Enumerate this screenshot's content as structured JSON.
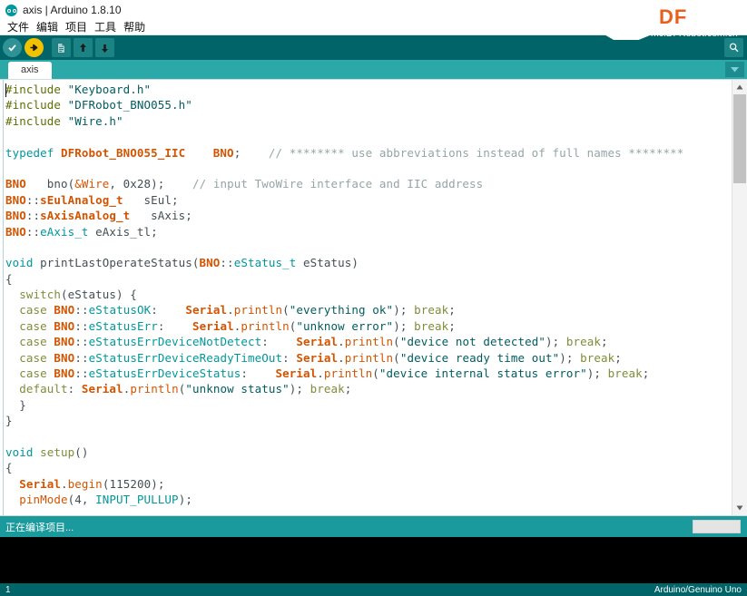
{
  "window": {
    "title": "axis | Arduino 1.8.10",
    "app_icon": "arduino-infinity-icon",
    "minimize_label": "–",
    "maximize_label": "□",
    "close_label": "✕"
  },
  "menubar": {
    "items": [
      {
        "label": "文件",
        "name": "menu-file"
      },
      {
        "label": "编辑",
        "name": "menu-edit"
      },
      {
        "label": "项目",
        "name": "menu-sketch"
      },
      {
        "label": "工具",
        "name": "menu-tools"
      },
      {
        "label": "帮助",
        "name": "menu-help"
      }
    ]
  },
  "toolbar": {
    "verify_label": "Verify",
    "upload_label": "Upload",
    "new_label": "New",
    "open_label": "Open",
    "save_label": "Save",
    "serial_monitor_label": "Serial Monitor"
  },
  "banner": {
    "logo_text": "DF",
    "url_text": "mc.DFRobot.com.cn",
    "logo_color": "#e8601c"
  },
  "tabbar": {
    "tabs": [
      {
        "label": "axis",
        "active": true
      }
    ],
    "menu_button_label": "▼"
  },
  "editor": {
    "lines": [
      {
        "segs": [
          {
            "t": "#include ",
            "c": "pre"
          },
          {
            "t": "\"Keyboard.h\"",
            "c": "str"
          }
        ]
      },
      {
        "segs": [
          {
            "t": "#include ",
            "c": "pre"
          },
          {
            "t": "\"DFRobot_BNO055.h\"",
            "c": "str"
          }
        ]
      },
      {
        "segs": [
          {
            "t": "#include ",
            "c": "pre"
          },
          {
            "t": "\"Wire.h\"",
            "c": "str"
          }
        ]
      },
      {
        "segs": []
      },
      {
        "segs": [
          {
            "t": "typedef ",
            "c": "kw"
          },
          {
            "t": "DFRobot_BNO055_IIC",
            "c": "type"
          },
          {
            "t": "    ",
            "c": "plain"
          },
          {
            "t": "BNO",
            "c": "type"
          },
          {
            "t": ";    ",
            "c": "plain"
          },
          {
            "t": "// ******** use abbreviations instead of full names ********",
            "c": "cmt"
          }
        ]
      },
      {
        "segs": []
      },
      {
        "segs": [
          {
            "t": "BNO",
            "c": "type"
          },
          {
            "t": "   bno(",
            "c": "plain"
          },
          {
            "t": "&Wire",
            "c": "fn"
          },
          {
            "t": ", 0x28);    ",
            "c": "plain"
          },
          {
            "t": "// input TwoWire interface and IIC address",
            "c": "cmt"
          }
        ]
      },
      {
        "segs": [
          {
            "t": "BNO",
            "c": "type"
          },
          {
            "t": "::",
            "c": "plain"
          },
          {
            "t": "sEulAnalog_t",
            "c": "type"
          },
          {
            "t": "   sEul;",
            "c": "plain"
          }
        ]
      },
      {
        "segs": [
          {
            "t": "BNO",
            "c": "type"
          },
          {
            "t": "::",
            "c": "plain"
          },
          {
            "t": "sAxisAnalog_t",
            "c": "type"
          },
          {
            "t": "   sAxis;",
            "c": "plain"
          }
        ]
      },
      {
        "segs": [
          {
            "t": "BNO",
            "c": "type"
          },
          {
            "t": "::",
            "c": "plain"
          },
          {
            "t": "eAxis_t",
            "c": "const"
          },
          {
            "t": " eAxis_tl;",
            "c": "plain"
          }
        ]
      },
      {
        "segs": []
      },
      {
        "segs": [
          {
            "t": "void",
            "c": "kw"
          },
          {
            "t": " printLastOperateStatus(",
            "c": "plain"
          },
          {
            "t": "BNO",
            "c": "type"
          },
          {
            "t": "::",
            "c": "plain"
          },
          {
            "t": "eStatus_t",
            "c": "const"
          },
          {
            "t": " eStatus)",
            "c": "plain"
          }
        ]
      },
      {
        "segs": [
          {
            "t": "{",
            "c": "plain"
          }
        ]
      },
      {
        "segs": [
          {
            "t": "  ",
            "c": "plain"
          },
          {
            "t": "switch",
            "c": "kw2"
          },
          {
            "t": "(eStatus) {",
            "c": "plain"
          }
        ]
      },
      {
        "segs": [
          {
            "t": "  ",
            "c": "plain"
          },
          {
            "t": "case",
            "c": "kw2"
          },
          {
            "t": " ",
            "c": "plain"
          },
          {
            "t": "BNO",
            "c": "type"
          },
          {
            "t": "::",
            "c": "plain"
          },
          {
            "t": "eStatusOK",
            "c": "const"
          },
          {
            "t": ":    ",
            "c": "plain"
          },
          {
            "t": "Serial",
            "c": "type"
          },
          {
            "t": ".",
            "c": "plain"
          },
          {
            "t": "println",
            "c": "fn"
          },
          {
            "t": "(",
            "c": "plain"
          },
          {
            "t": "\"everything ok\"",
            "c": "str"
          },
          {
            "t": "); ",
            "c": "plain"
          },
          {
            "t": "break",
            "c": "kw2"
          },
          {
            "t": ";",
            "c": "plain"
          }
        ]
      },
      {
        "segs": [
          {
            "t": "  ",
            "c": "plain"
          },
          {
            "t": "case",
            "c": "kw2"
          },
          {
            "t": " ",
            "c": "plain"
          },
          {
            "t": "BNO",
            "c": "type"
          },
          {
            "t": "::",
            "c": "plain"
          },
          {
            "t": "eStatusErr",
            "c": "const"
          },
          {
            "t": ":    ",
            "c": "plain"
          },
          {
            "t": "Serial",
            "c": "type"
          },
          {
            "t": ".",
            "c": "plain"
          },
          {
            "t": "println",
            "c": "fn"
          },
          {
            "t": "(",
            "c": "plain"
          },
          {
            "t": "\"unknow error\"",
            "c": "str"
          },
          {
            "t": "); ",
            "c": "plain"
          },
          {
            "t": "break",
            "c": "kw2"
          },
          {
            "t": ";",
            "c": "plain"
          }
        ]
      },
      {
        "segs": [
          {
            "t": "  ",
            "c": "plain"
          },
          {
            "t": "case",
            "c": "kw2"
          },
          {
            "t": " ",
            "c": "plain"
          },
          {
            "t": "BNO",
            "c": "type"
          },
          {
            "t": "::",
            "c": "plain"
          },
          {
            "t": "eStatusErrDeviceNotDetect",
            "c": "const"
          },
          {
            "t": ":    ",
            "c": "plain"
          },
          {
            "t": "Serial",
            "c": "type"
          },
          {
            "t": ".",
            "c": "plain"
          },
          {
            "t": "println",
            "c": "fn"
          },
          {
            "t": "(",
            "c": "plain"
          },
          {
            "t": "\"device not detected\"",
            "c": "str"
          },
          {
            "t": "); ",
            "c": "plain"
          },
          {
            "t": "break",
            "c": "kw2"
          },
          {
            "t": ";",
            "c": "plain"
          }
        ]
      },
      {
        "segs": [
          {
            "t": "  ",
            "c": "plain"
          },
          {
            "t": "case",
            "c": "kw2"
          },
          {
            "t": " ",
            "c": "plain"
          },
          {
            "t": "BNO",
            "c": "type"
          },
          {
            "t": "::",
            "c": "plain"
          },
          {
            "t": "eStatusErrDeviceReadyTimeOut",
            "c": "const"
          },
          {
            "t": ": ",
            "c": "plain"
          },
          {
            "t": "Serial",
            "c": "type"
          },
          {
            "t": ".",
            "c": "plain"
          },
          {
            "t": "println",
            "c": "fn"
          },
          {
            "t": "(",
            "c": "plain"
          },
          {
            "t": "\"device ready time out\"",
            "c": "str"
          },
          {
            "t": "); ",
            "c": "plain"
          },
          {
            "t": "break",
            "c": "kw2"
          },
          {
            "t": ";",
            "c": "plain"
          }
        ]
      },
      {
        "segs": [
          {
            "t": "  ",
            "c": "plain"
          },
          {
            "t": "case",
            "c": "kw2"
          },
          {
            "t": " ",
            "c": "plain"
          },
          {
            "t": "BNO",
            "c": "type"
          },
          {
            "t": "::",
            "c": "plain"
          },
          {
            "t": "eStatusErrDeviceStatus",
            "c": "const"
          },
          {
            "t": ":    ",
            "c": "plain"
          },
          {
            "t": "Serial",
            "c": "type"
          },
          {
            "t": ".",
            "c": "plain"
          },
          {
            "t": "println",
            "c": "fn"
          },
          {
            "t": "(",
            "c": "plain"
          },
          {
            "t": "\"device internal status error\"",
            "c": "str"
          },
          {
            "t": "); ",
            "c": "plain"
          },
          {
            "t": "break",
            "c": "kw2"
          },
          {
            "t": ";",
            "c": "plain"
          }
        ]
      },
      {
        "segs": [
          {
            "t": "  ",
            "c": "plain"
          },
          {
            "t": "default",
            "c": "kw2"
          },
          {
            "t": ": ",
            "c": "plain"
          },
          {
            "t": "Serial",
            "c": "type"
          },
          {
            "t": ".",
            "c": "plain"
          },
          {
            "t": "println",
            "c": "fn"
          },
          {
            "t": "(",
            "c": "plain"
          },
          {
            "t": "\"unknow status\"",
            "c": "str"
          },
          {
            "t": "); ",
            "c": "plain"
          },
          {
            "t": "break",
            "c": "kw2"
          },
          {
            "t": ";",
            "c": "plain"
          }
        ]
      },
      {
        "segs": [
          {
            "t": "  }",
            "c": "plain"
          }
        ]
      },
      {
        "segs": [
          {
            "t": "}",
            "c": "plain"
          }
        ]
      },
      {
        "segs": []
      },
      {
        "segs": [
          {
            "t": "void",
            "c": "kw"
          },
          {
            "t": " ",
            "c": "plain"
          },
          {
            "t": "setup",
            "c": "kw2"
          },
          {
            "t": "()",
            "c": "plain"
          }
        ]
      },
      {
        "segs": [
          {
            "t": "{",
            "c": "plain"
          }
        ]
      },
      {
        "segs": [
          {
            "t": "  ",
            "c": "plain"
          },
          {
            "t": "Serial",
            "c": "type"
          },
          {
            "t": ".",
            "c": "plain"
          },
          {
            "t": "begin",
            "c": "fn"
          },
          {
            "t": "(115200);",
            "c": "plain"
          }
        ]
      },
      {
        "segs": [
          {
            "t": "  ",
            "c": "plain"
          },
          {
            "t": "pinMode",
            "c": "fn"
          },
          {
            "t": "(4, ",
            "c": "plain"
          },
          {
            "t": "INPUT_PULLUP",
            "c": "const"
          },
          {
            "t": ");",
            "c": "plain"
          }
        ]
      }
    ]
  },
  "status": {
    "message": "正在编译项目...",
    "progress_percent": 0
  },
  "console": {
    "output": ""
  },
  "bottombar": {
    "line_number": "1",
    "board": "Arduino/Genuino Uno"
  }
}
